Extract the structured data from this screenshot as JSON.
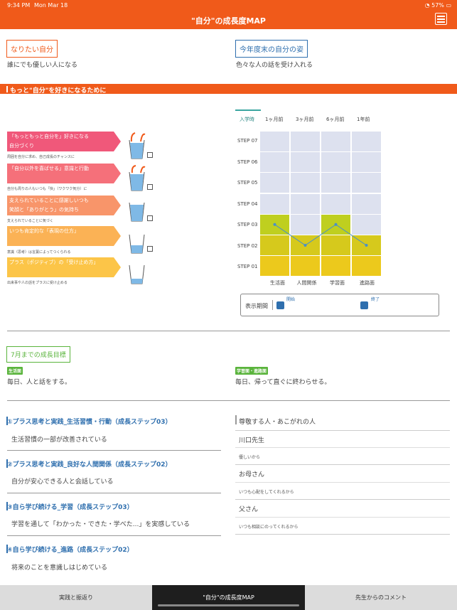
{
  "status": {
    "time": "9:34 PM",
    "date": "Mon Mar 18",
    "battery": "57%"
  },
  "header": {
    "title": "\"自分\"の成長度MAP"
  },
  "goal": {
    "label": "なりたい自分",
    "text": "誰にでも優しい人になる"
  },
  "year_end": {
    "label": "今年度末の自分の姿",
    "text": "色々な人の話を受け入れる"
  },
  "banner": "もっと\"自分\"を好きになるために",
  "steps": [
    {
      "line1": "「もっともっと自分を」好きになる",
      "line2": "自分づくり",
      "sub": "周囲を自分に求め、自己成長のチャンスに",
      "color": "#f0587a"
    },
    {
      "line1": "「自分以外を喜ばせる」意識と行動",
      "line2": "",
      "sub": "自分も周りの人もいつも「快」（ワクワク気分）に",
      "color": "#f5707a"
    },
    {
      "line1": "支えられていることに感謝しいつも",
      "line2": "笑顔と「ありがとう」の気持ち",
      "sub": "支えられていることに気づく",
      "color": "#f8956a"
    },
    {
      "line1": "いつも肯定的な「表現の仕方」",
      "line2": "",
      "sub": "意識（思考）は言葉によってつくられる",
      "color": "#fbb255"
    },
    {
      "line1": "プラス（ポジティブ）の「受け止め方」",
      "line2": "",
      "sub": "出来事や人の話をプラスに受け止める",
      "color": "#fcc548"
    }
  ],
  "period_tabs": [
    "入学時",
    "1ヶ月前",
    "3ヶ月前",
    "6ヶ月前",
    "1年前"
  ],
  "step_labels": [
    "STEP 07",
    "STEP 06",
    "STEP 05",
    "STEP 04",
    "STEP 03",
    "STEP 02",
    "STEP 01"
  ],
  "categories": [
    "生活面",
    "人間関係",
    "学習面",
    "進路面"
  ],
  "chart_data": {
    "type": "line",
    "categories": [
      "生活面",
      "人間関係",
      "学習面",
      "進路面"
    ],
    "values": [
      3,
      2,
      3,
      2
    ],
    "ylim": [
      1,
      7
    ],
    "colors": {
      "empty": "#dde1ef",
      "step1": "#ecc91c",
      "step2": "#d6c91c",
      "step3": "#bfcf1f",
      "line": "#4a90c8"
    }
  },
  "display_period": {
    "label": "表示期間",
    "start": "開始",
    "end": "終了"
  },
  "july": {
    "label": "7月までの成長目標",
    "tag_left": "生活面",
    "text_left": "毎日、人と話をする。",
    "tag_right": "学習面・進路面",
    "text_right": "毎日、帰って直ぐに終わらせる。"
  },
  "practices": [
    {
      "title": "①プラス思考と実践_生活習慣・行動（成長ステップ03）",
      "body": "生活習慣の一部が改善されている"
    },
    {
      "title": "②プラス思考と実践_良好な人間関係（成長ステップ02）",
      "body": "自分が安心できる人と会話している"
    },
    {
      "title": "③自ら学び続ける_学習（成長ステップ03）",
      "body": "学習を通して「わかった・できた・学べた...」を実感している"
    },
    {
      "title": "④自ら学び続ける_進路（成長ステップ02）",
      "body": "将来のことを意識しはじめている"
    }
  ],
  "respect": {
    "heading": "尊敬する人・あこがれの人",
    "people": [
      {
        "name": "川口先生",
        "reason": "優しいから"
      },
      {
        "name": "お母さん",
        "reason": "いつも心配をしてくれるから"
      },
      {
        "name": "父さん",
        "reason": "いつも相談にのってくれるから"
      }
    ]
  },
  "bottom_tabs": [
    "実践と振返り",
    "\"自分\"の成長度MAP",
    "先生からのコメント"
  ]
}
